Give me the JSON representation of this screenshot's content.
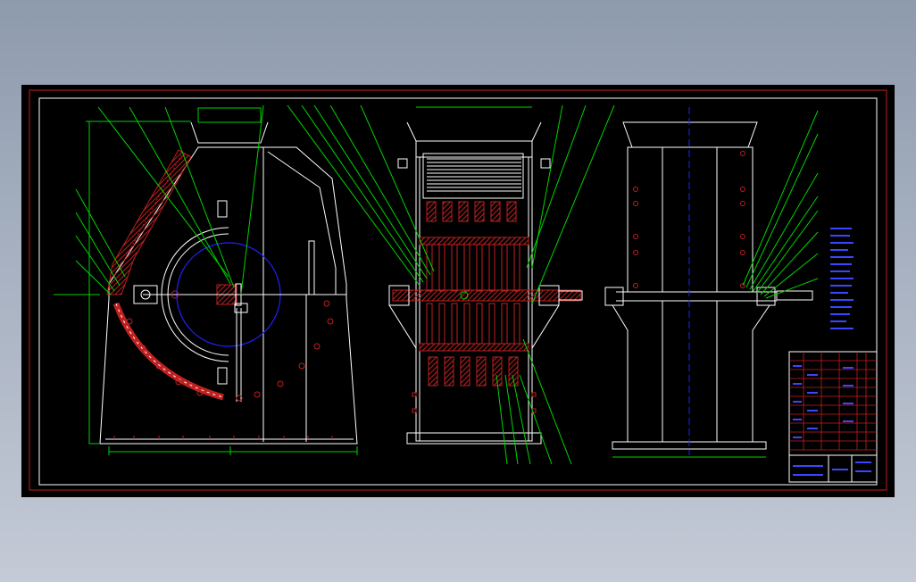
{
  "colors": {
    "background": "#000000",
    "outline": "#ffffff",
    "section_hatch": "#b02020",
    "leader": "#00d400",
    "frame": "#c81e1e",
    "rotor_circle": "#2020ff",
    "notes_text": "#3c46ff"
  },
  "views": [
    "side-section-view",
    "front-section-view",
    "right-side-view"
  ],
  "icons": [
    "rotor-circle",
    "shaft",
    "pulley",
    "bolt-hole",
    "hammer-plate"
  ]
}
